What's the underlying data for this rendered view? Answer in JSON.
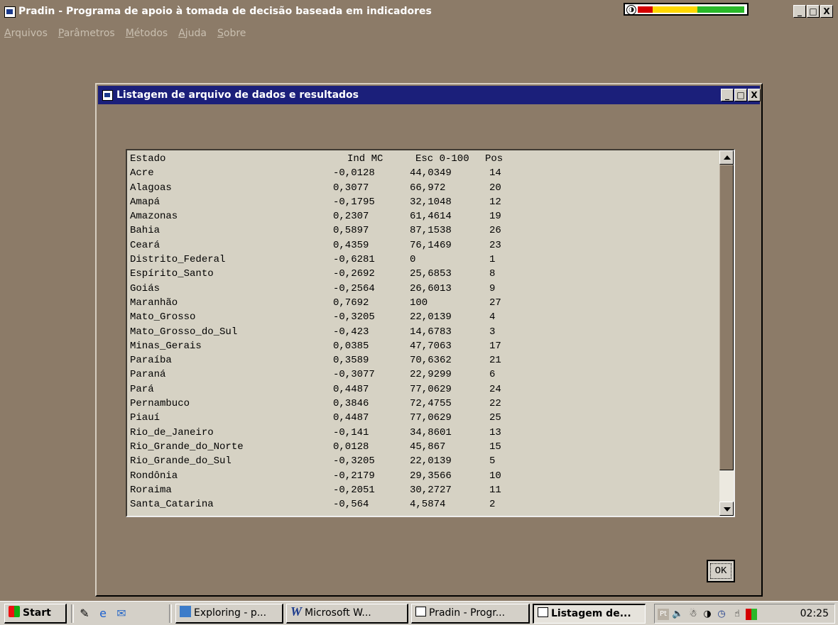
{
  "app": {
    "title": "Pradin - Programa de apoio à tomada de decisão baseada em indicadores",
    "window_buttons": {
      "minimize": "_",
      "maximize": "□",
      "close": "X"
    },
    "meter": {
      "colors": [
        "#d40000",
        "#ffd800",
        "#2ab82a"
      ]
    }
  },
  "menu": [
    {
      "accel": "A",
      "rest": "rquivos"
    },
    {
      "accel": "P",
      "rest": "arâmetros"
    },
    {
      "accel": "M",
      "rest": "étodos"
    },
    {
      "accel": "A",
      "rest": "juda"
    },
    {
      "accel": "S",
      "rest": "obre"
    }
  ],
  "dialog": {
    "title": "Listagem de arquivo de dados e resultados",
    "ok_label": "OK"
  },
  "table": {
    "headers": {
      "estado": "Estado",
      "ind": "Ind MC",
      "esc": "Esc 0-100",
      "pos": "Pos"
    },
    "rows": [
      {
        "estado": "Acre",
        "ind": "-0,0128",
        "esc": "44,0349",
        "pos": "14"
      },
      {
        "estado": "Alagoas",
        "ind": "0,3077",
        "esc": "66,972",
        "pos": "20"
      },
      {
        "estado": "Amapá",
        "ind": "-0,1795",
        "esc": "32,1048",
        "pos": "12"
      },
      {
        "estado": "Amazonas",
        "ind": "0,2307",
        "esc": "61,4614",
        "pos": "19"
      },
      {
        "estado": "Bahia",
        "ind": "0,5897",
        "esc": "87,1538",
        "pos": "26"
      },
      {
        "estado": "Ceará",
        "ind": "0,4359",
        "esc": "76,1469",
        "pos": "23"
      },
      {
        "estado": "Distrito_Federal",
        "ind": "-0,6281",
        "esc": "0",
        "pos": "1"
      },
      {
        "estado": "Espírito_Santo",
        "ind": "-0,2692",
        "esc": "25,6853",
        "pos": "8"
      },
      {
        "estado": "Goiás",
        "ind": "-0,2564",
        "esc": "26,6013",
        "pos": "9"
      },
      {
        "estado": "Maranhão",
        "ind": "0,7692",
        "esc": "100",
        "pos": "27"
      },
      {
        "estado": "Mato_Grosso",
        "ind": "-0,3205",
        "esc": "22,0139",
        "pos": "4"
      },
      {
        "estado": "Mato_Grosso_do_Sul",
        "ind": "-0,423",
        "esc": "14,6783",
        "pos": "3"
      },
      {
        "estado": "Minas_Gerais",
        "ind": "0,0385",
        "esc": "47,7063",
        "pos": "17"
      },
      {
        "estado": "Paraíba",
        "ind": "0,3589",
        "esc": "70,6362",
        "pos": "21"
      },
      {
        "estado": "Paraná",
        "ind": "-0,3077",
        "esc": "22,9299",
        "pos": "6"
      },
      {
        "estado": "Pará",
        "ind": "0,4487",
        "esc": "77,0629",
        "pos": "24"
      },
      {
        "estado": "Pernambuco",
        "ind": "0,3846",
        "esc": "72,4755",
        "pos": "22"
      },
      {
        "estado": "Piauí",
        "ind": "0,4487",
        "esc": "77,0629",
        "pos": "25"
      },
      {
        "estado": "Rio_de_Janeiro",
        "ind": "-0,141",
        "esc": "34,8601",
        "pos": "13"
      },
      {
        "estado": "Rio_Grande_do_Norte",
        "ind": "0,0128",
        "esc": "45,867",
        "pos": "15"
      },
      {
        "estado": "Rio_Grande_do_Sul",
        "ind": "-0,3205",
        "esc": "22,0139",
        "pos": "5"
      },
      {
        "estado": "Rondônia",
        "ind": "-0,2179",
        "esc": "29,3566",
        "pos": "10"
      },
      {
        "estado": "Roraima",
        "ind": "-0,2051",
        "esc": "30,2727",
        "pos": "11"
      },
      {
        "estado": "Santa_Catarina",
        "ind": "-0,564",
        "esc": "4,5874",
        "pos": "2"
      }
    ]
  },
  "taskbar": {
    "start_label": "Start",
    "items": [
      {
        "label": "Exploring - p...",
        "icon": "explorer-icon",
        "pressed": false
      },
      {
        "label": "Microsoft W...",
        "icon": "word-icon",
        "pressed": false
      },
      {
        "label": "Pradin - Progr...",
        "icon": "window-icon",
        "pressed": false
      },
      {
        "label": "Listagem de...",
        "icon": "window-icon",
        "pressed": true
      }
    ],
    "clock": "02:25",
    "tray_lang": "Pt"
  }
}
